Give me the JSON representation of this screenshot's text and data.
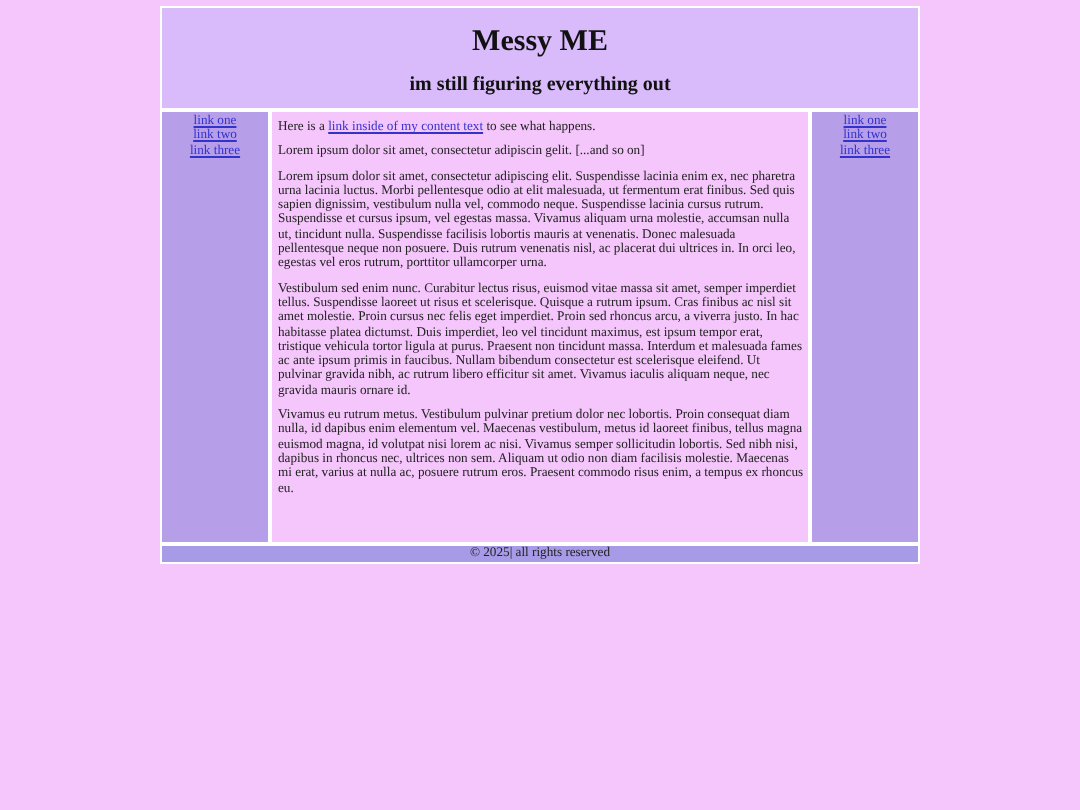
{
  "header": {
    "title": "Messy ME",
    "subtitle": "im still figuring everything out"
  },
  "left_nav": [
    "link one",
    "link two",
    "link three"
  ],
  "content": {
    "intro": {
      "before": "Here is a ",
      "link": "link inside of my content text",
      "after": " to see what happens."
    },
    "paragraphs": [
      "Lorem ipsum dolor sit amet, consectetur adipiscin gelit. [...and so on]",
      "Lorem ipsum dolor sit amet, consectetur adipiscing elit. Suspendisse lacinia enim ex, nec pharetra urna lacinia luctus. Morbi pellentesque odio at elit malesuada, ut fermentum erat finibus. Sed quis sapien dignissim, vestibulum nulla vel, commodo neque. Suspendisse lacinia cursus rutrum. Suspendisse et cursus ipsum, vel egestas massa. Vivamus aliquam urna molestie, accumsan nulla ut, tincidunt nulla. Suspendisse facilisis lobortis mauris at venenatis. Donec malesuada pellentesque neque non posuere. Duis rutrum venenatis nisl, ac placerat dui ultrices in. In orci leo, egestas vel eros rutrum, porttitor ullamcorper urna.",
      "Vestibulum sed enim nunc. Curabitur lectus risus, euismod vitae massa sit amet, semper imperdiet tellus. Suspendisse laoreet ut risus et scelerisque. Quisque a rutrum ipsum. Cras finibus ac nisl sit amet molestie. Proin cursus nec felis eget imperdiet. Proin sed rhoncus arcu, a viverra justo. In hac habitasse platea dictumst. Duis imperdiet, leo vel tincidunt maximus, est ipsum tempor erat, tristique vehicula tortor ligula at purus. Praesent non tincidunt massa. Interdum et malesuada fames ac ante ipsum primis in faucibus. Nullam bibendum consectetur est scelerisque eleifend. Ut pulvinar gravida nibh, ac rutrum libero efficitur sit amet. Vivamus iaculis aliquam neque, nec gravida mauris ornare id.",
      "Vivamus eu rutrum metus. Vestibulum pulvinar pretium dolor nec lobortis. Proin consequat diam nulla, id dapibus enim elementum vel. Maecenas vestibulum, metus id laoreet finibus, tellus magna euismod magna, id volutpat nisi lorem ac nisi. Vivamus semper sollicitudin lobortis. Sed nibh nisi, dapibus in rhoncus nec, ultrices non sem. Aliquam ut odio non diam facilisis molestie. Maecenas mi erat, varius at nulla ac, posuere rutrum eros. Praesent commodo risus enim, a tempus ex rhoncus eu."
    ]
  },
  "right_nav": [
    "link one",
    "link two",
    "link three"
  ],
  "footer": "© 2025| all rights reserved"
}
